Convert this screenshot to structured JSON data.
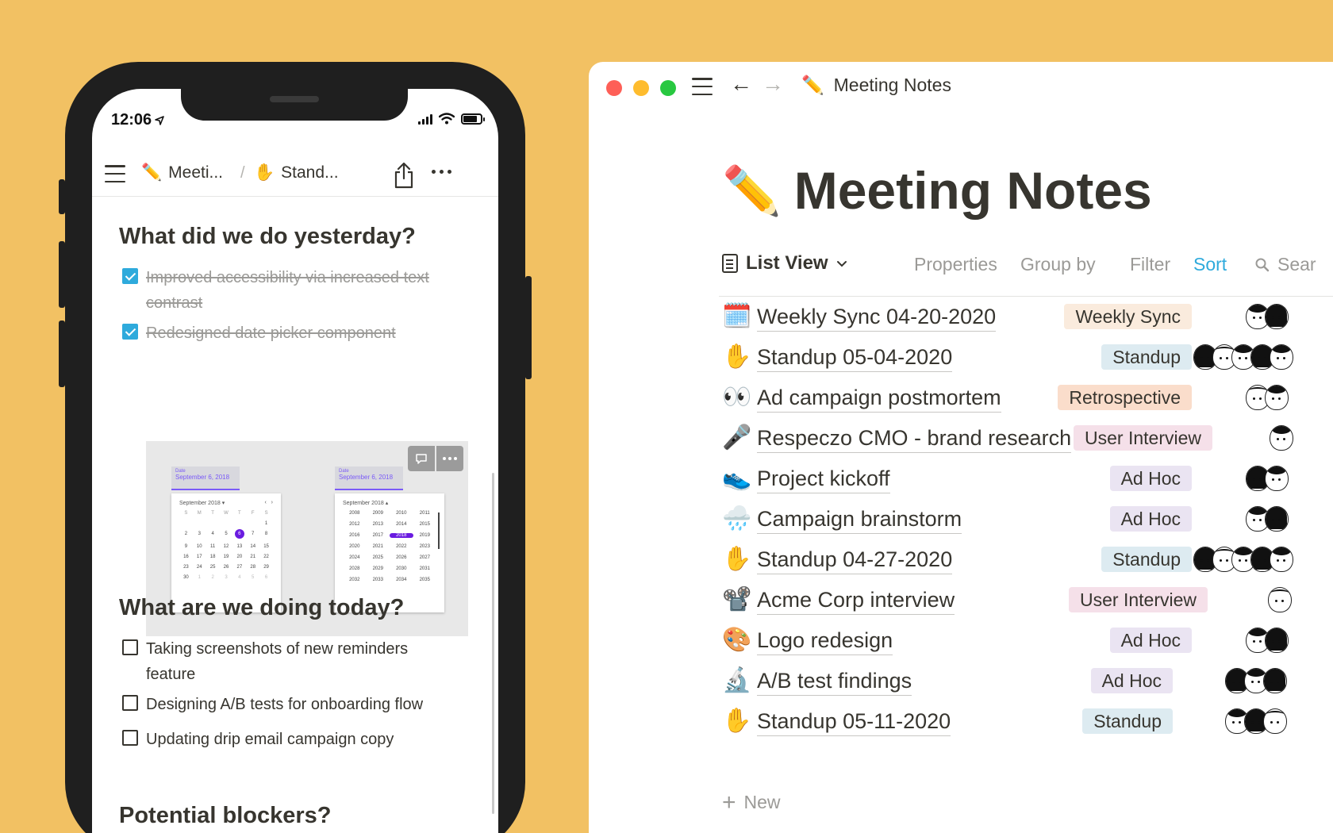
{
  "mobile": {
    "status": {
      "time": "12:06",
      "battery_level": 0.8
    },
    "breadcrumb": [
      {
        "emoji": "✏️",
        "label": "Meeti..."
      },
      {
        "emoji": "✋",
        "label": "Stand..."
      }
    ],
    "separator": "/",
    "sections": [
      {
        "heading": "What did we do yesterday?",
        "todos": [
          {
            "text": "Improved accessibility via increased text contrast",
            "checked": true
          },
          {
            "text": "Redesigned date picker component",
            "checked": true
          }
        ]
      },
      {
        "heading": "What are we doing today?",
        "todos": [
          {
            "text": "Taking screenshots of new reminders feature",
            "checked": false
          },
          {
            "text": "Designing A/B tests for onboarding flow",
            "checked": false
          },
          {
            "text": "Updating drip email campaign copy",
            "checked": false
          }
        ]
      },
      {
        "heading": "Potential blockers?"
      }
    ],
    "image": {
      "field_label": "Date",
      "field_value": "September 6, 2018",
      "month_label": "September 2018",
      "weekdays": [
        "S",
        "M",
        "T",
        "W",
        "T",
        "F",
        "S"
      ],
      "selected_day": "6",
      "selected_year": "2018"
    }
  },
  "window": {
    "title": {
      "emoji": "✏️",
      "label": "Meeting Notes"
    },
    "page_title": "Meeting Notes",
    "page_emoji": "✏️",
    "view": {
      "label": "List View"
    },
    "toolbar": {
      "properties": "Properties",
      "group_by": "Group by",
      "filter": "Filter",
      "sort": "Sort",
      "search": "Sear"
    },
    "rows": [
      {
        "emoji": "🗓️",
        "title": "Weekly Sync 04-20-2020",
        "tag": "Weekly Sync",
        "tag_color": "#FAEBDD",
        "avatars": 2
      },
      {
        "emoji": "✋",
        "title": "Standup 05-04-2020",
        "tag": "Standup",
        "tag_color": "#DDEBF1",
        "avatars": 5
      },
      {
        "emoji": "👀",
        "title": "Ad campaign postmortem",
        "tag": "Retrospective",
        "tag_color": "#FADDCB",
        "avatars": 2
      },
      {
        "emoji": "🎤",
        "title": "Respeczo CMO - brand research",
        "tag": "User Interview",
        "tag_color": "#F5E0E9",
        "avatars": 1
      },
      {
        "emoji": "👟",
        "title": "Project kickoff",
        "tag": "Ad Hoc",
        "tag_color": "#EAE4F2",
        "avatars": 2
      },
      {
        "emoji": "🌧️",
        "title": "Campaign brainstorm",
        "tag": "Ad Hoc",
        "tag_color": "#EAE4F2",
        "avatars": 2
      },
      {
        "emoji": "✋",
        "title": "Standup 04-27-2020",
        "tag": "Standup",
        "tag_color": "#DDEBF1",
        "avatars": 5
      },
      {
        "emoji": "📽️",
        "title": "Acme Corp interview",
        "tag": "User Interview",
        "tag_color": "#F5E0E9",
        "avatars": 1
      },
      {
        "emoji": "🎨",
        "title": "Logo redesign",
        "tag": "Ad Hoc",
        "tag_color": "#EAE4F2",
        "avatars": 2
      },
      {
        "emoji": "🔬",
        "title": "A/B test findings",
        "tag": "Ad Hoc",
        "tag_color": "#EAE4F2",
        "avatars": 3
      },
      {
        "emoji": "✋",
        "title": "Standup 05-11-2020",
        "tag": "Standup",
        "tag_color": "#DDEBF1",
        "avatars": 3
      }
    ],
    "new_label": "New"
  },
  "colors": {
    "background": "#F2C163",
    "accent": "#2EAADC",
    "text": "#37352F",
    "muted": "#9B9A97"
  }
}
